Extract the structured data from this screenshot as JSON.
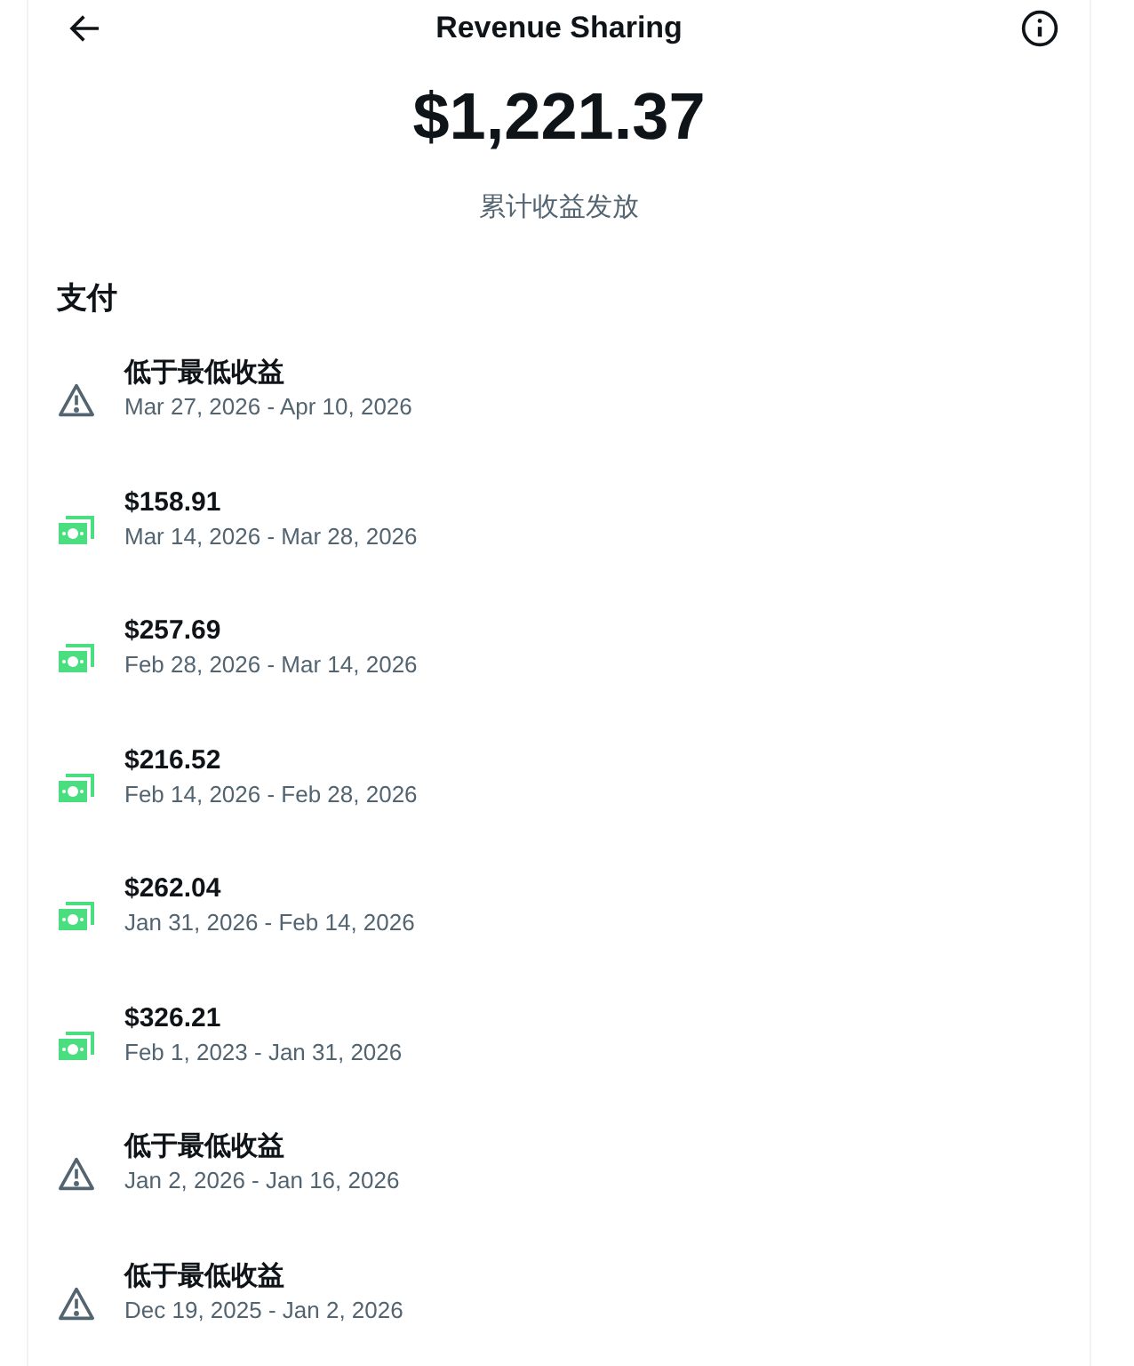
{
  "header": {
    "title": "Revenue Sharing"
  },
  "total": {
    "amount": "$1,221.37",
    "caption": "累计收益发放"
  },
  "section_title": "支付",
  "payments": [
    {
      "kind": "below_minimum",
      "title": "低于最低收益",
      "period": "Mar 27, 2026 - Apr 10, 2026"
    },
    {
      "kind": "payout",
      "title": "$158.91",
      "period": "Mar 14, 2026 - Mar 28, 2026"
    },
    {
      "kind": "payout",
      "title": "$257.69",
      "period": "Feb 28, 2026 - Mar 14, 2026"
    },
    {
      "kind": "payout",
      "title": "$216.52",
      "period": "Feb 14, 2026 - Feb 28, 2026"
    },
    {
      "kind": "payout",
      "title": "$262.04",
      "period": "Jan 31, 2026 - Feb 14, 2026"
    },
    {
      "kind": "payout",
      "title": "$326.21",
      "period": "Feb 1, 2023 - Jan 31, 2026"
    },
    {
      "kind": "below_minimum",
      "title": "低于最低收益",
      "period": "Jan 2, 2026 - Jan 16, 2026"
    },
    {
      "kind": "below_minimum",
      "title": "低于最低收益",
      "period": "Dec 19, 2025 - Jan 2, 2026"
    }
  ]
}
